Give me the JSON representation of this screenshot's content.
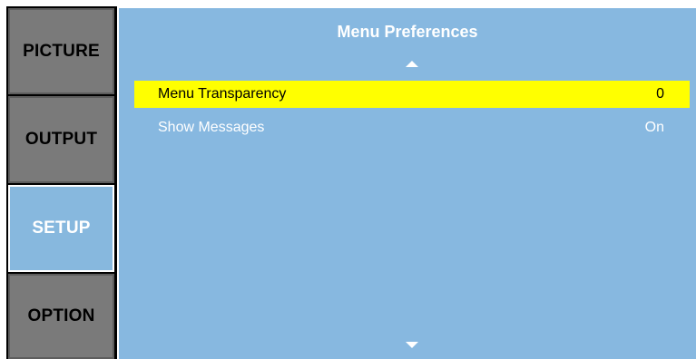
{
  "sidebar": {
    "tabs": [
      {
        "label": "PICTURE",
        "active": false
      },
      {
        "label": "OUTPUT",
        "active": false
      },
      {
        "label": "SETUP",
        "active": true
      },
      {
        "label": "OPTION",
        "active": false
      }
    ]
  },
  "main": {
    "title": "Menu Preferences",
    "items": [
      {
        "label": "Menu Transparency",
        "value": "0",
        "selected": true
      },
      {
        "label": "Show Messages",
        "value": "On",
        "selected": false
      }
    ],
    "scroll_up_icon": "triangle-up-icon",
    "scroll_down_icon": "triangle-down-icon"
  },
  "colors": {
    "panel_background": "#87b8e0",
    "tab_inactive": "#7a7a7a",
    "tab_active": "#87b8de",
    "highlight": "#ffff00",
    "text_light": "#ffffff",
    "text_dark": "#000000"
  }
}
